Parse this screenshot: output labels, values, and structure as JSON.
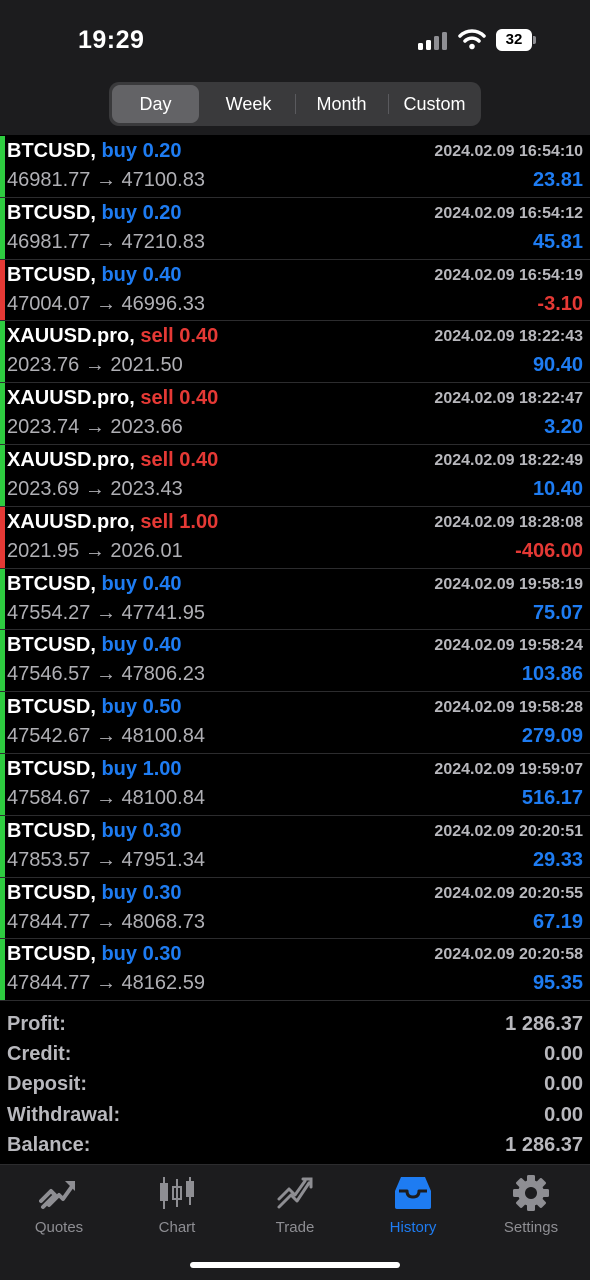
{
  "status_bar": {
    "time": "19:29",
    "battery": "32"
  },
  "periods": [
    {
      "label": "Day",
      "active": true
    },
    {
      "label": "Week",
      "active": false
    },
    {
      "label": "Month",
      "active": false
    },
    {
      "label": "Custom",
      "active": false
    }
  ],
  "colors": {
    "buy": "#1e7cf2",
    "sell": "#e53935",
    "profit": "#1e7cf2",
    "loss": "#e53935",
    "bar_profit": "#2ecc40",
    "bar_loss": "#e53935"
  },
  "deals": [
    {
      "symbol": "BTCUSD,",
      "side": "buy",
      "volume": "0.20",
      "date": "2024.02.09 16:54:10",
      "prices": "46981.77 → 47100.83",
      "profit": "23.81"
    },
    {
      "symbol": "BTCUSD,",
      "side": "buy",
      "volume": "0.20",
      "date": "2024.02.09 16:54:12",
      "prices": "46981.77 → 47210.83",
      "profit": "45.81"
    },
    {
      "symbol": "BTCUSD,",
      "side": "buy",
      "volume": "0.40",
      "date": "2024.02.09 16:54:19",
      "prices": "47004.07 → 46996.33",
      "profit": "-3.10"
    },
    {
      "symbol": "XAUUSD.pro,",
      "side": "sell",
      "volume": "0.40",
      "date": "2024.02.09 18:22:43",
      "prices": "2023.76 → 2021.50",
      "profit": "90.40"
    },
    {
      "symbol": "XAUUSD.pro,",
      "side": "sell",
      "volume": "0.40",
      "date": "2024.02.09 18:22:47",
      "prices": "2023.74 → 2023.66",
      "profit": "3.20"
    },
    {
      "symbol": "XAUUSD.pro,",
      "side": "sell",
      "volume": "0.40",
      "date": "2024.02.09 18:22:49",
      "prices": "2023.69 → 2023.43",
      "profit": "10.40"
    },
    {
      "symbol": "XAUUSD.pro,",
      "side": "sell",
      "volume": "1.00",
      "date": "2024.02.09 18:28:08",
      "prices": "2021.95 → 2026.01",
      "profit": "-406.00"
    },
    {
      "symbol": "BTCUSD,",
      "side": "buy",
      "volume": "0.40",
      "date": "2024.02.09 19:58:19",
      "prices": "47554.27 → 47741.95",
      "profit": "75.07"
    },
    {
      "symbol": "BTCUSD,",
      "side": "buy",
      "volume": "0.40",
      "date": "2024.02.09 19:58:24",
      "prices": "47546.57 → 47806.23",
      "profit": "103.86"
    },
    {
      "symbol": "BTCUSD,",
      "side": "buy",
      "volume": "0.50",
      "date": "2024.02.09 19:58:28",
      "prices": "47542.67 → 48100.84",
      "profit": "279.09"
    },
    {
      "symbol": "BTCUSD,",
      "side": "buy",
      "volume": "1.00",
      "date": "2024.02.09 19:59:07",
      "prices": "47584.67 → 48100.84",
      "profit": "516.17"
    },
    {
      "symbol": "BTCUSD,",
      "side": "buy",
      "volume": "0.30",
      "date": "2024.02.09 20:20:51",
      "prices": "47853.57 → 47951.34",
      "profit": "29.33"
    },
    {
      "symbol": "BTCUSD,",
      "side": "buy",
      "volume": "0.30",
      "date": "2024.02.09 20:20:55",
      "prices": "47844.77 → 48068.73",
      "profit": "67.19"
    },
    {
      "symbol": "BTCUSD,",
      "side": "buy",
      "volume": "0.30",
      "date": "2024.02.09 20:20:58",
      "prices": "47844.77 → 48162.59",
      "profit": "95.35"
    }
  ],
  "summary": [
    {
      "label": "Profit:",
      "value": "1 286.37"
    },
    {
      "label": "Credit:",
      "value": "0.00"
    },
    {
      "label": "Deposit:",
      "value": "0.00"
    },
    {
      "label": "Withdrawal:",
      "value": "0.00"
    },
    {
      "label": "Balance:",
      "value": "1 286.37"
    }
  ],
  "tabs": [
    {
      "label": "Quotes",
      "icon": "quotes-icon",
      "active": false
    },
    {
      "label": "Chart",
      "icon": "chart-icon",
      "active": false
    },
    {
      "label": "Trade",
      "icon": "trade-icon",
      "active": false
    },
    {
      "label": "History",
      "icon": "history-icon",
      "active": true
    },
    {
      "label": "Settings",
      "icon": "settings-icon",
      "active": false
    }
  ]
}
